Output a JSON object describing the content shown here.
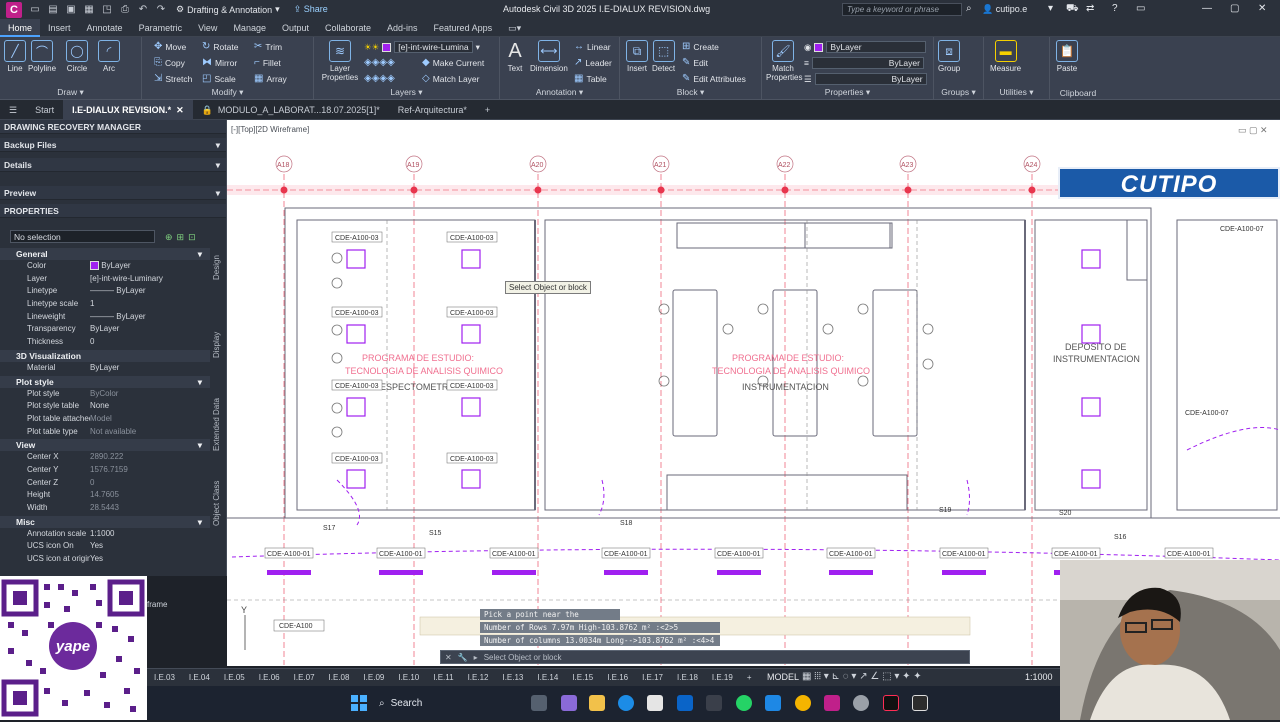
{
  "app": {
    "workspace": "Drafting & Annotation",
    "share_label": "Share",
    "title": "Autodesk Civil 3D 2025   I.E-DIALUX REVISION.dwg",
    "search_placeholder": "Type a keyword or phrase",
    "user": "cutipo.e",
    "app_icon_letter": "C"
  },
  "menu_tabs": [
    "Home",
    "Insert",
    "Annotate",
    "Parametric",
    "View",
    "Manage",
    "Output",
    "Collaborate",
    "Add-ins",
    "Featured Apps"
  ],
  "ribbon": {
    "draw": {
      "label": "Draw",
      "big": [
        "Line",
        "Polyline",
        "Circle",
        "Arc"
      ]
    },
    "modify": {
      "label": "Modify",
      "rows": [
        [
          "Move",
          "Rotate",
          "Trim"
        ],
        [
          "Copy",
          "Mirror",
          "Fillet"
        ],
        [
          "Stretch",
          "Scale",
          "Array"
        ]
      ]
    },
    "layers": {
      "label": "Layers",
      "big": "Layer Properties",
      "combo": "[e]-int-wire-Lumina",
      "make_current": "Make Current",
      "match_layer": "Match Layer"
    },
    "annotation": {
      "label": "Annotation",
      "text": "Text",
      "dimension": "Dimension",
      "linear": "Linear",
      "leader": "Leader",
      "table": "Table"
    },
    "block": {
      "label": "Block",
      "insert": "Insert",
      "detect": "Detect",
      "create": "Create",
      "edit": "Edit",
      "edit_attributes": "Edit Attributes"
    },
    "properties": {
      "label": "Properties",
      "match": "Match Properties",
      "color": "ByLayer",
      "linetype": "ByLayer",
      "lineweight": "ByLayer"
    },
    "groups": {
      "label": "Groups",
      "group": "Group"
    },
    "utilities": {
      "label": "Utilities",
      "measure": "Measure"
    },
    "clipboard": {
      "label": "Clipboard",
      "paste": "Paste"
    }
  },
  "doc_tabs": [
    "Start",
    "I.E-DIALUX REVISION.*",
    "MODULO_A_LABORAT...18.07.2025[1]*",
    "Ref-Arquitectura*"
  ],
  "palette": {
    "recovery_title": "DRAWING RECOVERY MANAGER",
    "backup_files": "Backup Files",
    "details": "Details",
    "preview": "Preview",
    "properties_title": "PROPERTIES",
    "selection": "No selection",
    "sections": {
      "general": {
        "title": "General",
        "rows": [
          [
            "Color",
            "ByLayer"
          ],
          [
            "Layer",
            "[e]-int-wire-Luminary"
          ],
          [
            "Linetype",
            "ByLayer"
          ],
          [
            "Linetype scale",
            "1"
          ],
          [
            "Lineweight",
            "ByLayer"
          ],
          [
            "Transparency",
            "ByLayer"
          ],
          [
            "Thickness",
            "0"
          ]
        ]
      },
      "viz": {
        "title": "3D Visualization",
        "rows": [
          [
            "Material",
            "ByLayer"
          ]
        ]
      },
      "plot": {
        "title": "Plot style",
        "rows": [
          [
            "Plot style",
            "ByColor"
          ],
          [
            "Plot style table",
            "None"
          ],
          [
            "Plot table attached to",
            "Model"
          ],
          [
            "Plot table type",
            "Not available"
          ]
        ]
      },
      "view": {
        "title": "View",
        "rows": [
          [
            "Center X",
            "2890.222"
          ],
          [
            "Center Y",
            "1576.7159"
          ],
          [
            "Center Z",
            "0"
          ],
          [
            "Height",
            "14.7605"
          ],
          [
            "Width",
            "28.5443"
          ]
        ]
      },
      "misc": {
        "title": "Misc",
        "rows": [
          [
            "Annotation scale",
            "1:1000"
          ],
          [
            "UCS icon On",
            "Yes"
          ],
          [
            "UCS icon at origin",
            "Yes"
          ]
        ]
      }
    },
    "side_tabs": [
      "Design",
      "Display",
      "Extended Data",
      "Object Class"
    ],
    "frame_fragment": "frame"
  },
  "viewport": {
    "label": "[-][Top][2D Wireframe]",
    "tooltip": "Select Object or block",
    "grid_labels": [
      "A18",
      "A19",
      "A20",
      "A21",
      "A22",
      "A23",
      "A24"
    ],
    "room_texts": [
      "PROGRAMA DE ESTUDIO:",
      "TECNOLOGIA DE ANALISIS QUIMICO",
      "ESPECTOMETRIA",
      "INSTRUMENTACION",
      "DEPOSITO DE",
      "INSTRUMENTACION"
    ],
    "tags": [
      "CDE-A100-03",
      "CDE-A100-03",
      "CDE-A100-03",
      "CDE-A100-03",
      "CDE-A100-03",
      "CDE-A100-03",
      "CDE-A100-03",
      "CDE-A100-03"
    ],
    "bottom_tags": [
      "CDE-A100-01",
      "CDE-A100-01",
      "CDE-A100-01",
      "CDE-A100-01",
      "CDE-A100-01",
      "CDE-A100-01",
      "CDE-A100-01",
      "CDE-A100-01",
      "CDE-A100-01"
    ],
    "switch_labels": [
      "S17",
      "S15",
      "S18",
      "S19",
      "S20",
      "S16"
    ],
    "right_tags": [
      "CDE-A100-07",
      "CDE-A100-07"
    ],
    "bottom_left_tag": "CDE-A100",
    "watermark": "CUTIPO"
  },
  "command": {
    "history": [
      "Pick a point near the segment:",
      "Number of Rows 7.97m High-103.8762 m² :<2>5",
      "Number of columns 13.0034m Long-->103.8762 m² :<4>4"
    ],
    "prompt": "Select Object or block"
  },
  "status": {
    "layouts": [
      "I.E.03",
      "I.E.04",
      "I.E.05",
      "I.E.06",
      "I.E.07",
      "I.E.08",
      "I.E.09",
      "I.E.10",
      "I.E.11",
      "I.E.12",
      "I.E.13",
      "I.E.14",
      "I.E.15",
      "I.E.16",
      "I.E.17",
      "I.E.18",
      "I.E.19"
    ],
    "model": "MODEL",
    "scale": "1:1000"
  },
  "taskbar": {
    "search": "Search"
  },
  "qr": {
    "brand": "yape"
  },
  "colors": {
    "magenta": "#a020f0",
    "red": "#e8364e",
    "accent": "#4da3ff"
  }
}
